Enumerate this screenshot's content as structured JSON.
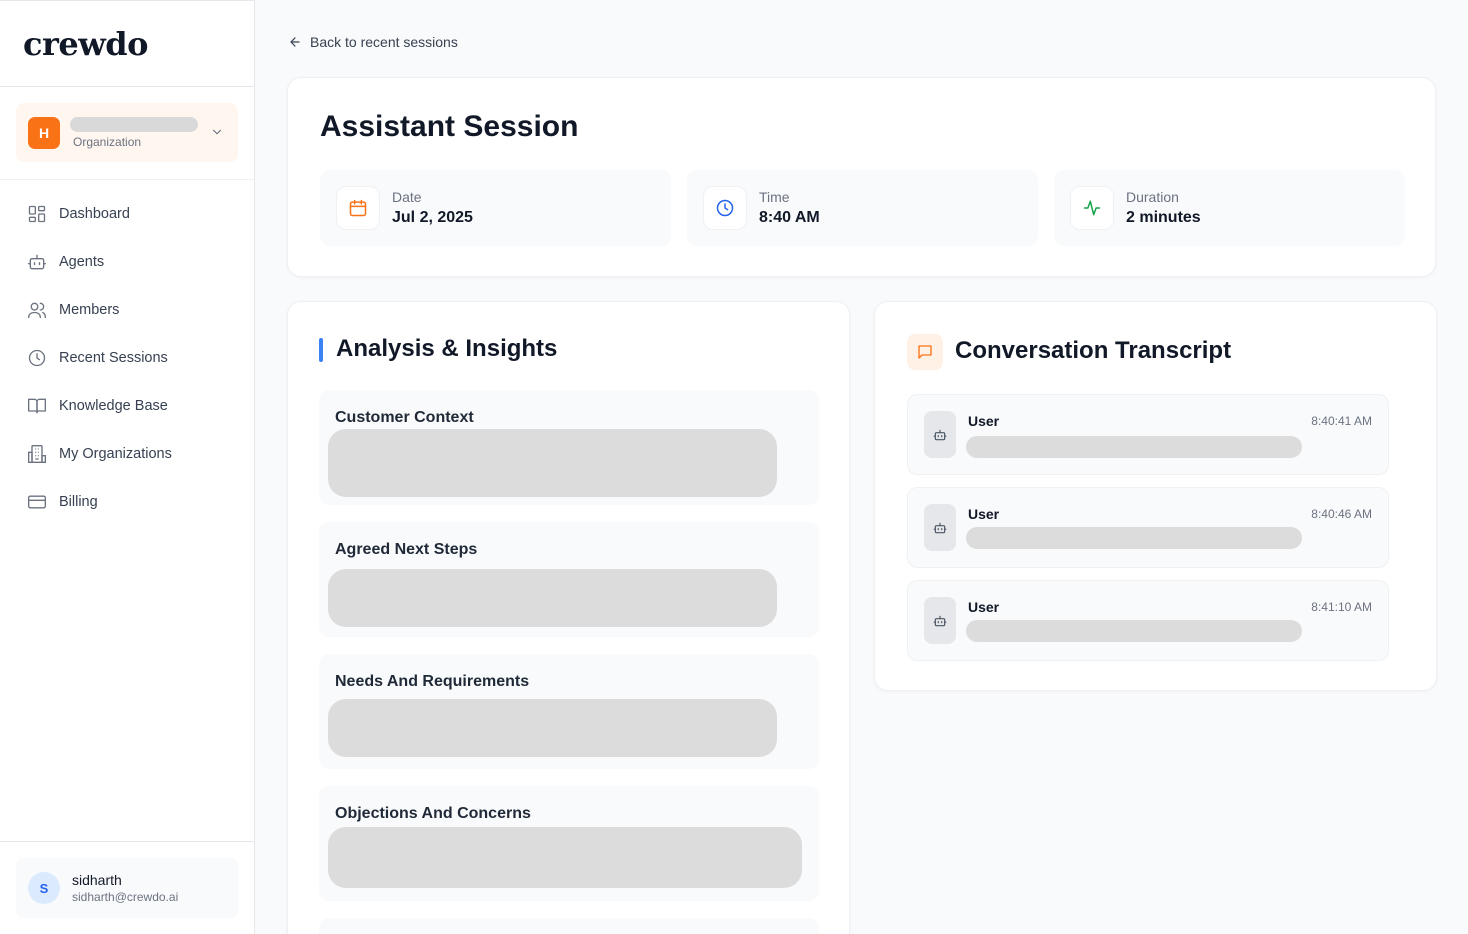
{
  "app": {
    "logo": "crewdo"
  },
  "org": {
    "initial": "H",
    "label": "Organization"
  },
  "nav": {
    "items": [
      {
        "label": "Dashboard"
      },
      {
        "label": "Agents"
      },
      {
        "label": "Members"
      },
      {
        "label": "Recent Sessions"
      },
      {
        "label": "Knowledge Base"
      },
      {
        "label": "My Organizations"
      },
      {
        "label": "Billing"
      }
    ]
  },
  "user": {
    "initial": "S",
    "name": "sidharth",
    "email": "sidharth@crewdo.ai"
  },
  "back_link": "Back to recent sessions",
  "session": {
    "title": "Assistant Session",
    "date_label": "Date",
    "date_value": "Jul 2, 2025",
    "time_label": "Time",
    "time_value": "8:40 AM",
    "duration_label": "Duration",
    "duration_value": "2 minutes"
  },
  "analysis": {
    "title": "Analysis & Insights",
    "sections": [
      {
        "title": "Customer Context"
      },
      {
        "title": "Agreed Next Steps"
      },
      {
        "title": "Needs And Requirements"
      },
      {
        "title": "Objections And Concerns"
      }
    ]
  },
  "transcript": {
    "title": "Conversation Transcript",
    "messages": [
      {
        "speaker": "User",
        "time": "8:40:41 AM"
      },
      {
        "speaker": "User",
        "time": "8:40:46 AM"
      },
      {
        "speaker": "User",
        "time": "8:41:10 AM"
      }
    ]
  },
  "colors": {
    "accent_orange": "#f97316",
    "accent_blue": "#3b82f6",
    "accent_green": "#16a34a"
  }
}
